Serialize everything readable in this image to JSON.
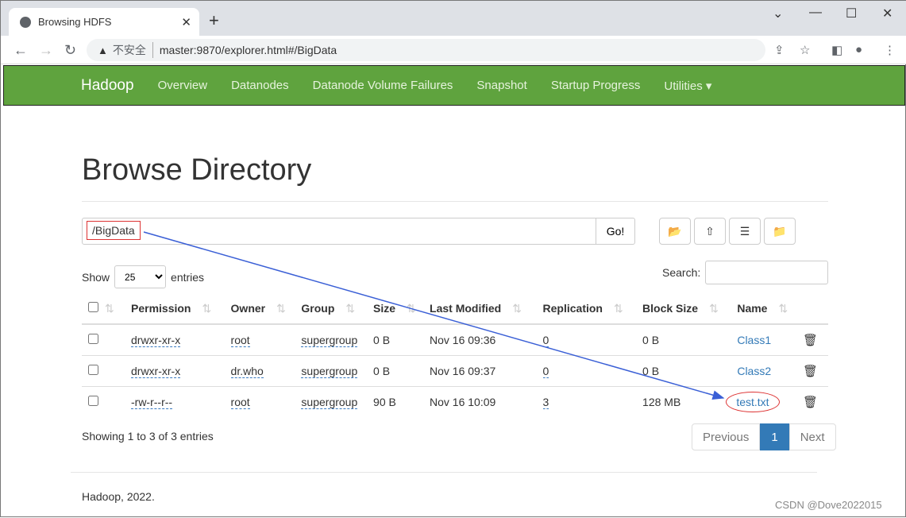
{
  "browser": {
    "tab_title": "Browsing HDFS",
    "url": "master:9870/explorer.html#/BigData",
    "insecure_label": "不安全"
  },
  "navbar": {
    "brand": "Hadoop",
    "links": [
      "Overview",
      "Datanodes",
      "Datanode Volume Failures",
      "Snapshot",
      "Startup Progress",
      "Utilities ▾"
    ]
  },
  "page": {
    "title": "Browse Directory",
    "path": "/BigData",
    "go_label": "Go!"
  },
  "controls": {
    "show_label": "Show",
    "entries_value": "25",
    "entries_label": "entries",
    "search_label": "Search:"
  },
  "table": {
    "headers": [
      "Permission",
      "Owner",
      "Group",
      "Size",
      "Last Modified",
      "Replication",
      "Block Size",
      "Name"
    ],
    "rows": [
      [
        "drwxr-xr-x",
        "root",
        "supergroup",
        "0 B",
        "Nov 16 09:36",
        "0",
        "0 B",
        "Class1"
      ],
      [
        "drwxr-xr-x",
        "dr.who",
        "supergroup",
        "0 B",
        "Nov 16 09:37",
        "0",
        "0 B",
        "Class2"
      ],
      [
        "-rw-r--r--",
        "root",
        "supergroup",
        "90 B",
        "Nov 16 10:09",
        "3",
        "128 MB",
        "test.txt"
      ]
    ]
  },
  "info": "Showing 1 to 3 of 3 entries",
  "pager": {
    "prev": "Previous",
    "current": "1",
    "next": "Next"
  },
  "footer": "Hadoop, 2022.",
  "watermark": "CSDN @Dove2022015",
  "colors": {
    "navbar": "#5fa33e",
    "link": "#337ab7",
    "annotation": "#3a5fd6",
    "highlight": "#dd3333"
  }
}
